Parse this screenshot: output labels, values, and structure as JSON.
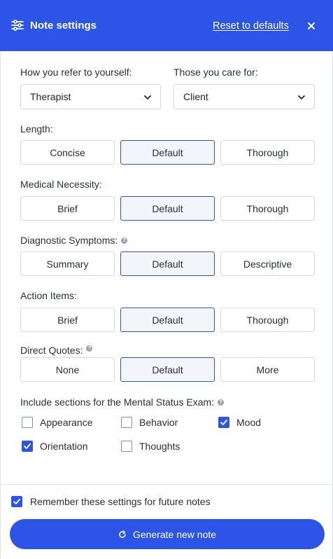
{
  "header": {
    "title": "Note settings",
    "reset_label": "Reset to defaults",
    "accent_color": "#2c54e6",
    "icons": {
      "left": "sliders-icon",
      "close": "close-icon"
    }
  },
  "pronouns": {
    "self_label": "How you refer to yourself:",
    "self_value": "Therapist",
    "others_label": "Those you care for:",
    "others_value": "Client"
  },
  "length": {
    "label": "Length:",
    "options": [
      "Concise",
      "Default",
      "Thorough"
    ],
    "selected": "Default"
  },
  "medical_necessity": {
    "label": "Medical Necessity:",
    "options": [
      "Brief",
      "Default",
      "Thorough"
    ],
    "selected": "Default"
  },
  "diagnostic_symptoms": {
    "label": "Diagnostic Symptoms:",
    "options": [
      "Summary",
      "Default",
      "Descriptive"
    ],
    "selected": "Default"
  },
  "action_items": {
    "label": "Action Items:",
    "options": [
      "Brief",
      "Default",
      "Thorough"
    ],
    "selected": "Default"
  },
  "direct_quotes": {
    "label": "Direct Quotes:",
    "options": [
      "None",
      "Default",
      "More"
    ],
    "selected": "Default"
  },
  "mse": {
    "label": "Include sections for the Mental Status Exam:",
    "items": [
      {
        "label": "Appearance",
        "checked": false
      },
      {
        "label": "Behavior",
        "checked": false
      },
      {
        "label": "Mood",
        "checked": true
      },
      {
        "label": "Orientation",
        "checked": true
      },
      {
        "label": "Thoughts",
        "checked": false
      }
    ]
  },
  "footer": {
    "remember_label": "Remember these settings for future notes",
    "remember_checked": true,
    "generate_label": "Generate new note"
  }
}
